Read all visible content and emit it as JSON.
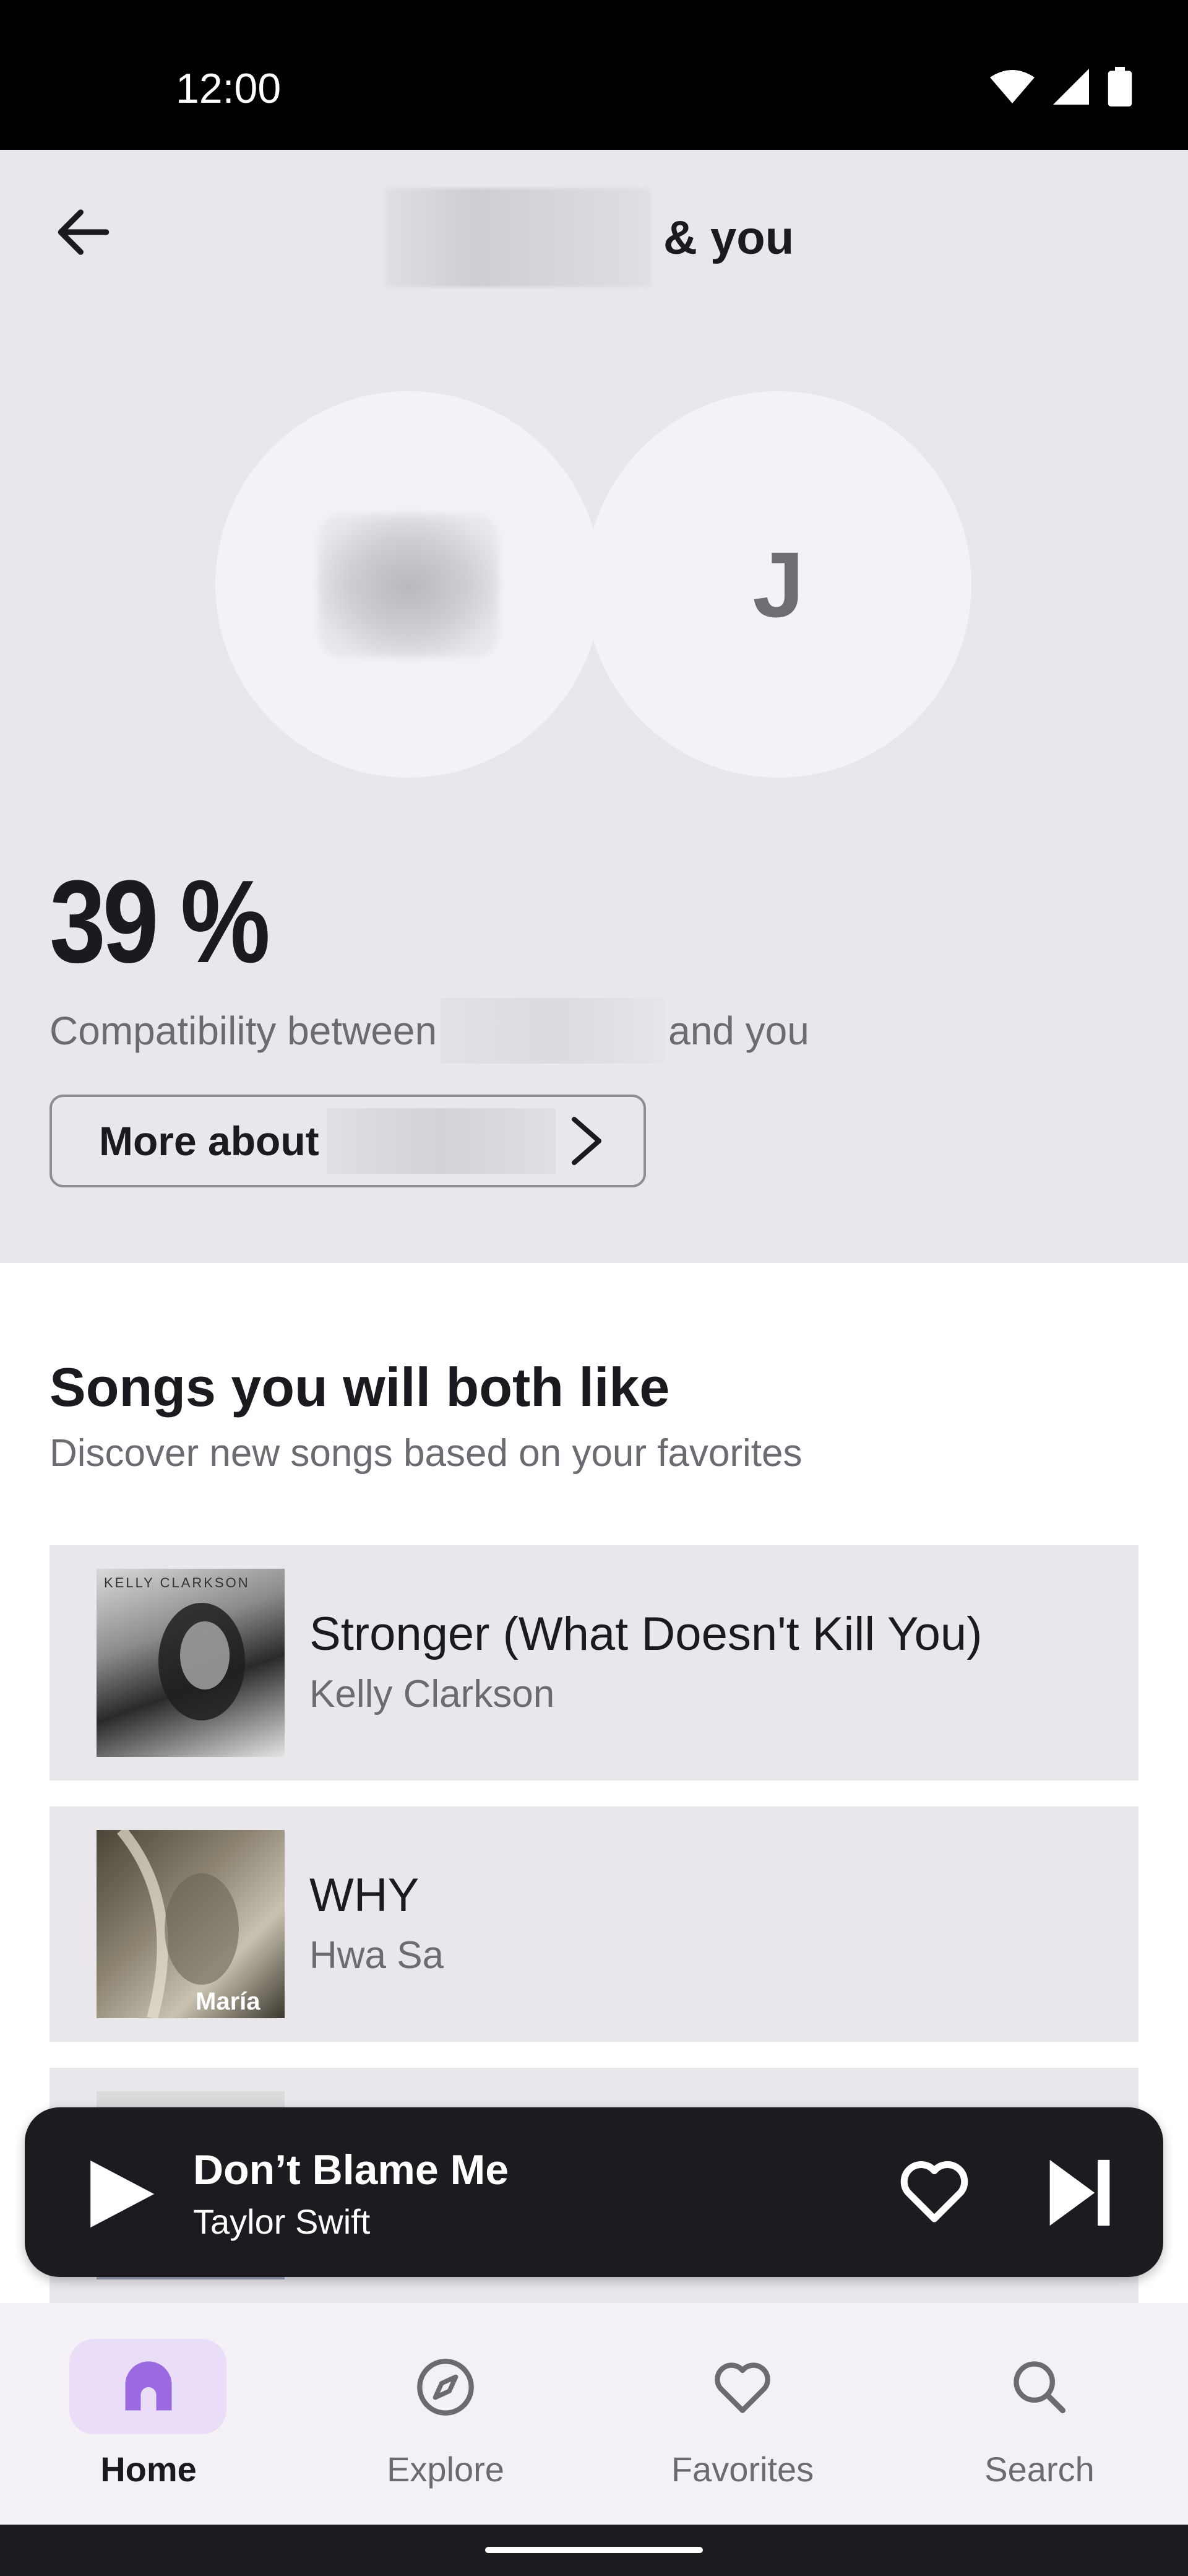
{
  "status_bar": {
    "time": "12:00"
  },
  "header": {
    "title_suffix": "& you"
  },
  "avatars": {
    "right_initial": "J"
  },
  "compatibility": {
    "percent": "39 %",
    "prefix": "Compatibility between",
    "suffix": "and you",
    "more_button_label": "More about"
  },
  "section": {
    "title": "Songs you will both like",
    "subtitle": "Discover new songs based on your favorites"
  },
  "songs": [
    {
      "title": "Stronger (What Doesn't Kill You)",
      "artist": "Kelly Clarkson",
      "art_text": "KELLY CLARKSON"
    },
    {
      "title": "WHY",
      "artist": "Hwa Sa",
      "art_text": "María"
    }
  ],
  "player": {
    "title": "Don’t Blame Me",
    "artist": "Taylor Swift"
  },
  "nav": {
    "items": [
      {
        "label": "Home",
        "icon": "home-icon",
        "active": true
      },
      {
        "label": "Explore",
        "icon": "compass-icon",
        "active": false
      },
      {
        "label": "Favorites",
        "icon": "heart-icon",
        "active": false
      },
      {
        "label": "Search",
        "icon": "search-icon",
        "active": false
      }
    ]
  },
  "colors": {
    "accent": "#9c6ae0",
    "accent_container": "#eaddf7",
    "surface": "#e9e7ec",
    "player_bg": "#1d1b20"
  }
}
